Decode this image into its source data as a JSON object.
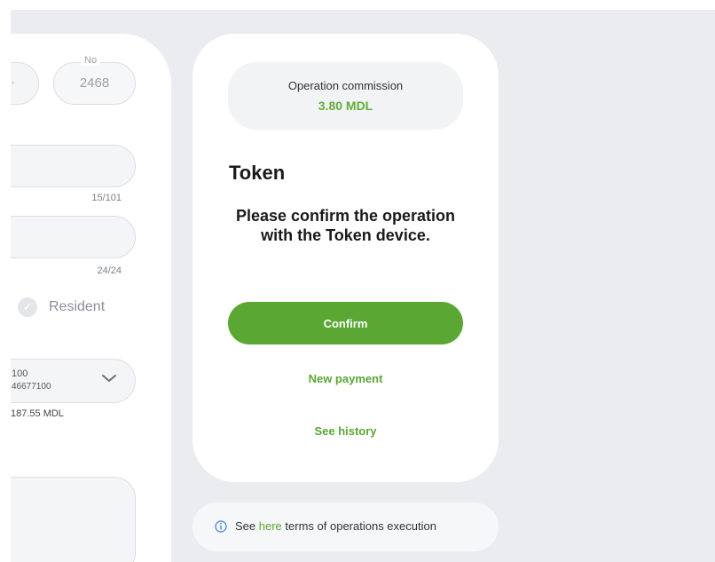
{
  "form": {
    "currency_value": "·",
    "number_label": "No",
    "number_value": "2468",
    "field1_counter": "15/101",
    "field2_counter": "24/24",
    "resident_label": "Resident",
    "account_line1": "100",
    "account_line2": "46677100",
    "balance": "187.55 MDL"
  },
  "token_card": {
    "commission_title": "Operation commission",
    "commission_value": "3.80 MDL",
    "heading": "Token",
    "message": "Please confirm the operation with the Token device.",
    "confirm_label": "Confirm",
    "new_payment_label": "New payment",
    "history_label": "See history"
  },
  "terms": {
    "prefix": "See",
    "link": "here",
    "suffix": "terms of operations execution"
  },
  "colors": {
    "accent": "#5aa734",
    "background": "#ebecef"
  }
}
